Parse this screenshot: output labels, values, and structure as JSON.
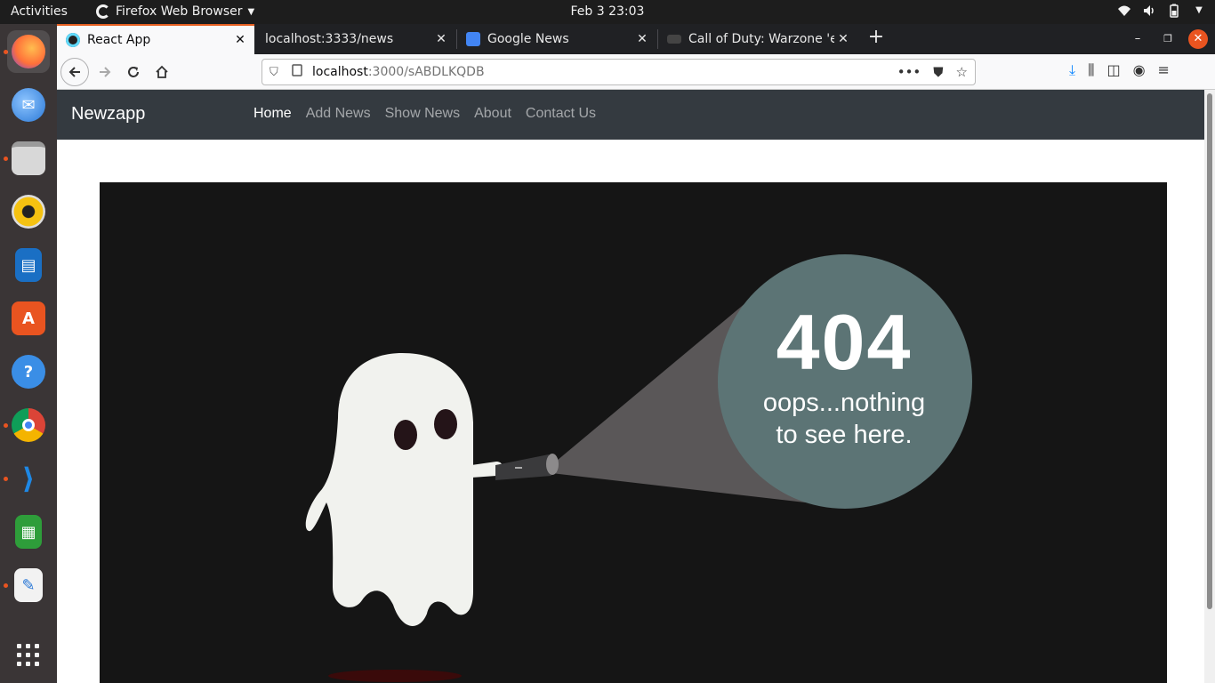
{
  "system": {
    "activities": "Activities",
    "app_menu": "Firefox Web Browser",
    "clock": "Feb 3  23:03"
  },
  "dock": [
    {
      "name": "firefox",
      "color": "#ff7139",
      "active": true
    },
    {
      "name": "thunderbird",
      "color": "#2a78d6"
    },
    {
      "name": "files",
      "color": "#9a9a9a"
    },
    {
      "name": "rhythmbox",
      "color": "#f5c211"
    },
    {
      "name": "writer",
      "color": "#1a6fc4"
    },
    {
      "name": "software",
      "color": "#e95420"
    },
    {
      "name": "help",
      "color": "#3a8ee6"
    },
    {
      "name": "chrome",
      "color": "#3e9b45"
    },
    {
      "name": "vscode",
      "color": "#1e88e5"
    },
    {
      "name": "calc",
      "color": "#2e9d3a"
    },
    {
      "name": "text-editor",
      "color": "#f2f2f2"
    },
    {
      "name": "show-apps",
      "color": "#3a3536"
    }
  ],
  "browser": {
    "tabs": [
      {
        "title": "React App",
        "favicon_color": "#222",
        "active": true
      },
      {
        "title": "localhost:3333/news",
        "favicon_color": ""
      },
      {
        "title": "Google News",
        "favicon_color": "#4285f4"
      },
      {
        "title": "Call of Duty: Warzone 'er",
        "favicon_color": "#444"
      }
    ],
    "url_host": "localhost",
    "url_path": ":3000/sABDLKQDB"
  },
  "app": {
    "brand": "Newzapp",
    "nav": [
      {
        "label": "Home",
        "active": true
      },
      {
        "label": "Add News"
      },
      {
        "label": "Show News"
      },
      {
        "label": "About"
      },
      {
        "label": "Contact Us"
      }
    ]
  },
  "not_found": {
    "code": "404",
    "line1": "oops...nothing",
    "line2": "to see here."
  },
  "colors": {
    "accent": "#e95420",
    "appnav_bg": "#343a40",
    "stage_bg": "#151515",
    "bubble": "#5c7475"
  }
}
